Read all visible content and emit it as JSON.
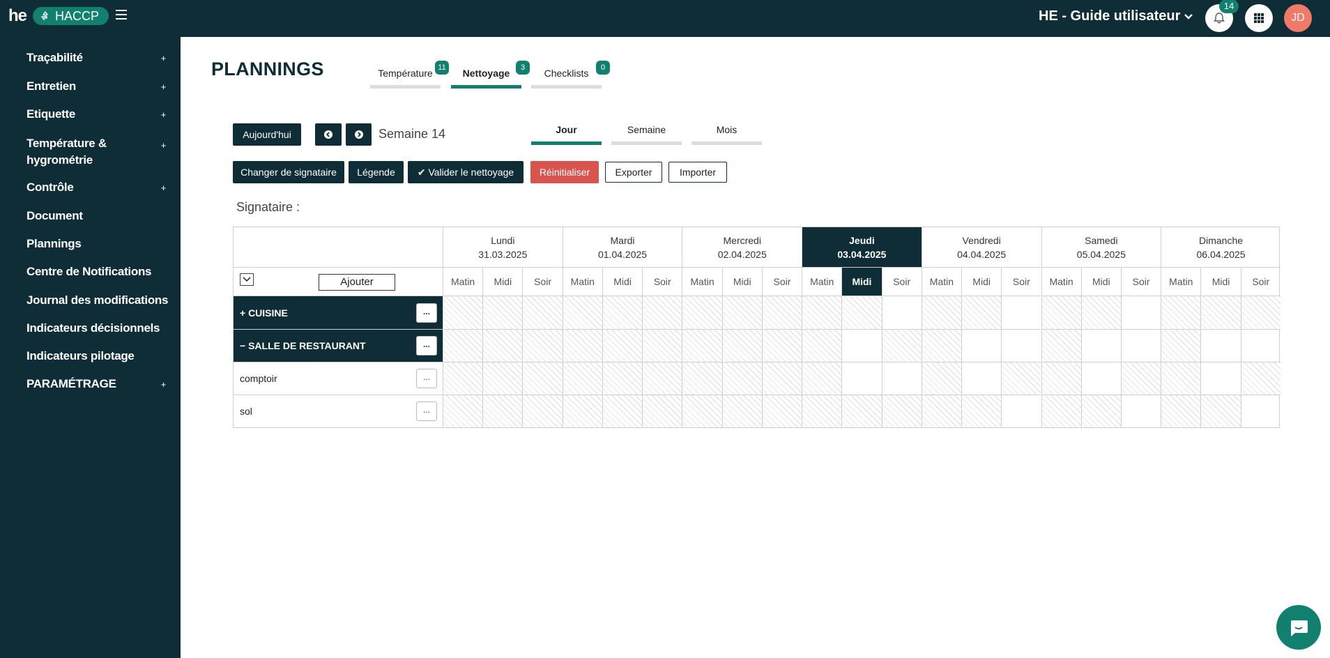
{
  "brand": {
    "logo": "he",
    "app": "HACCP"
  },
  "header": {
    "org": "HE - Guide utilisateur",
    "notifications": "14",
    "avatar": "JD"
  },
  "sidebar": {
    "items": [
      {
        "label": "Traçabilité",
        "plus": "+"
      },
      {
        "label": "Entretien",
        "plus": "+"
      },
      {
        "label": "Etiquette",
        "plus": "+"
      },
      {
        "label": "Température & hygrométrie",
        "plus": "+"
      },
      {
        "label": "Contrôle",
        "plus": "+"
      },
      {
        "label": "Document",
        "plus": ""
      },
      {
        "label": "Plannings",
        "plus": ""
      },
      {
        "label": "Centre de Notifications",
        "plus": ""
      },
      {
        "label": "Journal des modifications",
        "plus": ""
      },
      {
        "label": "Indicateurs décisionnels",
        "plus": ""
      },
      {
        "label": "Indicateurs pilotage",
        "plus": ""
      },
      {
        "label": "PARAMÉTRAGE",
        "plus": "+"
      }
    ]
  },
  "page": {
    "title": "PLANNINGS",
    "tabs": [
      {
        "label": "Température",
        "count": "11"
      },
      {
        "label": "Nettoyage",
        "count": "3"
      },
      {
        "label": "Checklists",
        "count": "0"
      }
    ],
    "toolbar": {
      "today": "Aujourd'hui",
      "prev": "‹",
      "next": "›",
      "week": "Semaine 14",
      "views": [
        "Jour",
        "Semaine",
        "Mois"
      ],
      "change_signer": "Changer de signataire",
      "legend": "Légende",
      "validate": "Valider le nettoyage",
      "reset": "Réinitialiser",
      "export": "Exporter",
      "import": "Importer"
    },
    "signataire": "Signataire :",
    "grid": {
      "add": "Ajouter",
      "days": [
        {
          "name": "Lundi",
          "date": "31.03.2025"
        },
        {
          "name": "Mardi",
          "date": "01.04.2025"
        },
        {
          "name": "Mercredi",
          "date": "02.04.2025"
        },
        {
          "name": "Jeudi",
          "date": "03.04.2025"
        },
        {
          "name": "Vendredi",
          "date": "04.04.2025"
        },
        {
          "name": "Samedi",
          "date": "05.04.2025"
        },
        {
          "name": "Dimanche",
          "date": "06.04.2025"
        }
      ],
      "slots": [
        "Matin",
        "Midi",
        "Soir"
      ],
      "rows": [
        {
          "label": "+ CUISINE",
          "type": "group",
          "dots": "...",
          "hatch": [
            1,
            1,
            1,
            1,
            1,
            1,
            1,
            1,
            1,
            1,
            1,
            0,
            1,
            1,
            0,
            1,
            1,
            0,
            1,
            1,
            1
          ]
        },
        {
          "label": "− SALLE DE RESTAURANT",
          "type": "group",
          "dots": "...",
          "hatch": [
            1,
            1,
            1,
            1,
            1,
            1,
            1,
            1,
            1,
            1,
            0,
            1,
            1,
            0,
            0,
            1,
            0,
            0,
            1,
            0,
            0
          ]
        },
        {
          "label": "comptoir",
          "type": "item",
          "dots": "...",
          "hatch": [
            1,
            1,
            1,
            1,
            1,
            1,
            1,
            1,
            1,
            1,
            0,
            0,
            1,
            0,
            1,
            1,
            0,
            1,
            1,
            0,
            1
          ]
        },
        {
          "label": "sol",
          "type": "item",
          "dots": "...",
          "hatch": [
            1,
            1,
            1,
            1,
            1,
            1,
            1,
            1,
            1,
            1,
            1,
            1,
            1,
            1,
            0,
            1,
            1,
            0,
            1,
            1,
            0
          ]
        }
      ]
    }
  }
}
